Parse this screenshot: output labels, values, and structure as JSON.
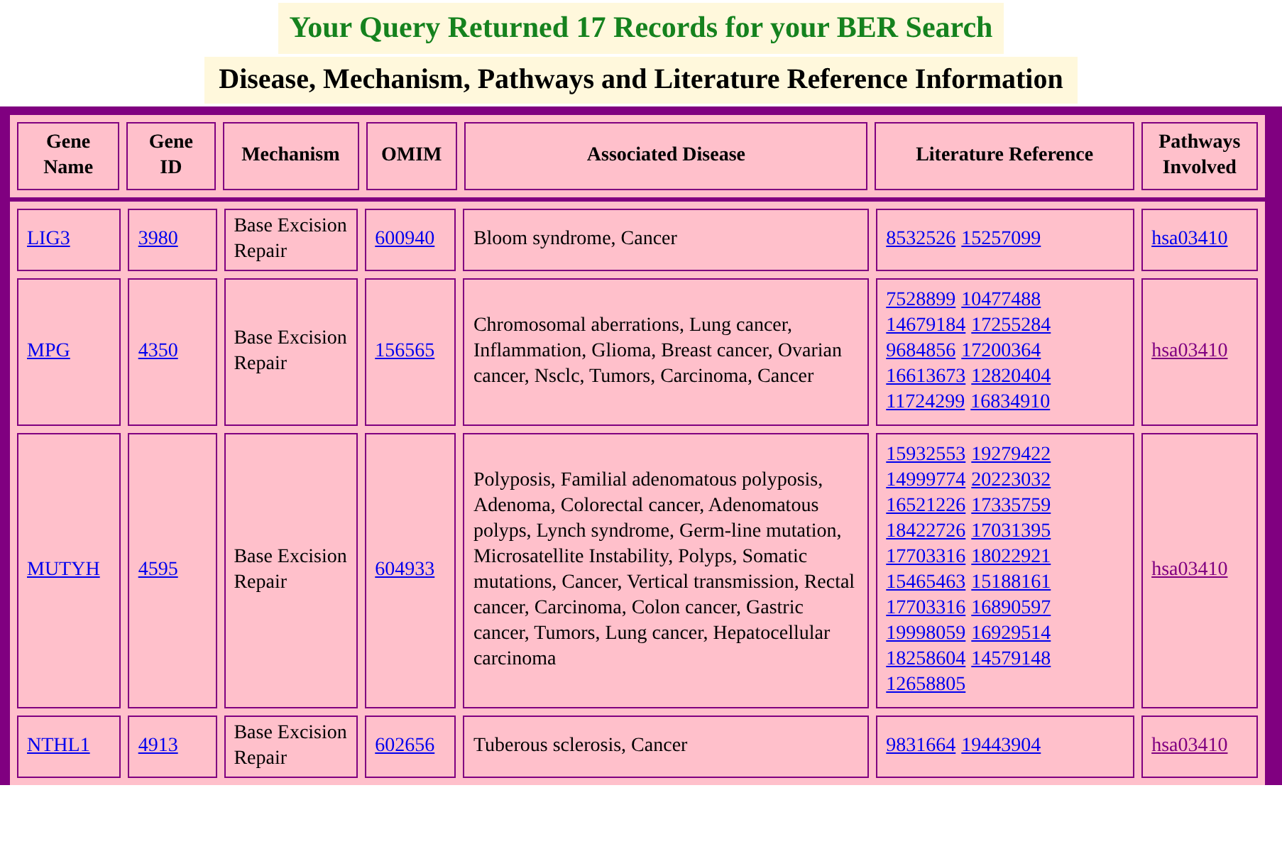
{
  "title": "Your Query Returned 17 Records for your BER Search",
  "subtitle": "Disease, Mechanism, Pathways and Literature Reference Information",
  "table": {
    "columns": [
      "Gene Name",
      "Gene ID",
      "Mechanism",
      "OMIM",
      "Associated Disease",
      "Literature Reference",
      "Pathways Involved"
    ],
    "rows": [
      {
        "gene_name": "LIG3",
        "gene_id": "3980",
        "mechanism": "Base Excision Repair",
        "omim": "600940",
        "disease": "Bloom syndrome, Cancer",
        "references": [
          "8532526",
          "15257099"
        ],
        "pathway": {
          "label": "hsa03410",
          "visited": false
        }
      },
      {
        "gene_name": "MPG",
        "gene_id": "4350",
        "mechanism": "Base Excision Repair",
        "omim": "156565",
        "disease": "Chromosomal aberrations, Lung cancer, Inflammation, Glioma, Breast cancer, Ovarian cancer, Nsclc, Tumors, Carcinoma, Cancer",
        "references": [
          "7528899",
          "10477488",
          "14679184",
          "17255284",
          "9684856",
          "17200364",
          "16613673",
          "12820404",
          "11724299",
          "16834910"
        ],
        "pathway": {
          "label": "hsa03410",
          "visited": true
        }
      },
      {
        "gene_name": "MUTYH",
        "gene_id": "4595",
        "mechanism": "Base Excision Repair",
        "omim": "604933",
        "disease": "Polyposis, Familial adenomatous polyposis, Adenoma, Colorectal cancer, Adenomatous polyps, Lynch syndrome, Germ-line mutation, Microsatellite Instability, Polyps, Somatic mutations, Cancer, Vertical transmission, Rectal cancer, Carcinoma, Colon cancer, Gastric cancer, Tumors, Lung cancer, Hepatocellular carcinoma",
        "references": [
          "15932553",
          "19279422",
          "14999774",
          "20223032",
          "16521226",
          "17335759",
          "18422726",
          "17031395",
          "17703316",
          "18022921",
          "15465463",
          "15188161",
          "17703316",
          "16890597",
          "19998059",
          "16929514",
          "18258604",
          "14579148",
          "12658805"
        ],
        "pathway": {
          "label": "hsa03410",
          "visited": true
        }
      },
      {
        "gene_name": "NTHL1",
        "gene_id": "4913",
        "mechanism": "Base Excision Repair",
        "omim": "602656",
        "disease": "Tuberous sclerosis, Cancer",
        "references": [
          "9831664",
          "19443904"
        ],
        "pathway": {
          "label": "hsa03410",
          "visited": true
        }
      }
    ]
  }
}
